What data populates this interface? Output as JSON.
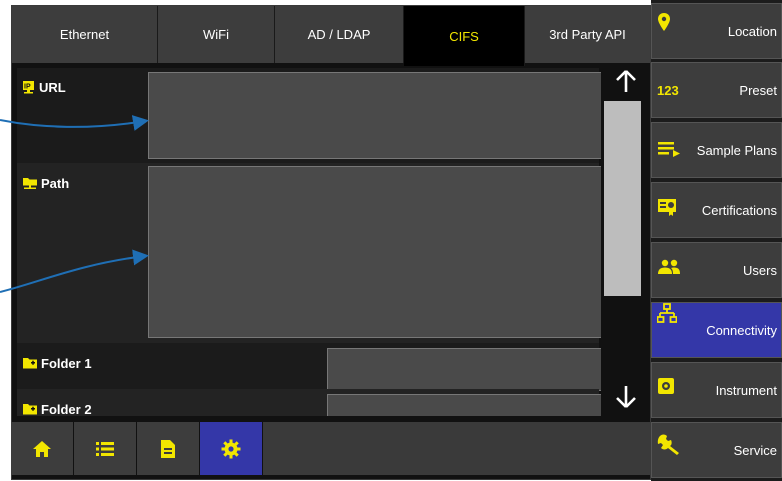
{
  "tabs": [
    {
      "label": "Ethernet"
    },
    {
      "label": "WiFi"
    },
    {
      "label": "AD / LDAP"
    },
    {
      "label": "CIFS"
    },
    {
      "label": "3rd Party API"
    }
  ],
  "active_tab": "CIFS",
  "fields": {
    "url_label": "URL",
    "path_label": "Path",
    "folder1_label": "Folder 1",
    "folder2_label": "Folder 2",
    "url_value": "",
    "path_value": "",
    "folder1_value": "",
    "folder2_value": ""
  },
  "bottom_nav": [
    {
      "icon": "home-icon"
    },
    {
      "icon": "list-icon"
    },
    {
      "icon": "document-icon"
    },
    {
      "icon": "gear-icon"
    }
  ],
  "sidebar": {
    "items": [
      {
        "label": "Location",
        "icon": "location-pin-icon"
      },
      {
        "label": "Preset",
        "icon": "123-icon",
        "icon_text": "123"
      },
      {
        "label": "Sample Plans",
        "icon": "sample-plans-icon"
      },
      {
        "label": "Certifications",
        "icon": "certificate-icon"
      },
      {
        "label": "Users",
        "icon": "users-icon"
      },
      {
        "label": "Connectivity",
        "icon": "network-icon"
      },
      {
        "label": "Instrument",
        "icon": "instrument-icon"
      },
      {
        "label": "Service",
        "icon": "wrench-icon"
      }
    ]
  },
  "colors": {
    "accent_yellow": "#f2e600",
    "active_blue": "#3437a8",
    "annotation_blue": "#1f6fb5"
  }
}
